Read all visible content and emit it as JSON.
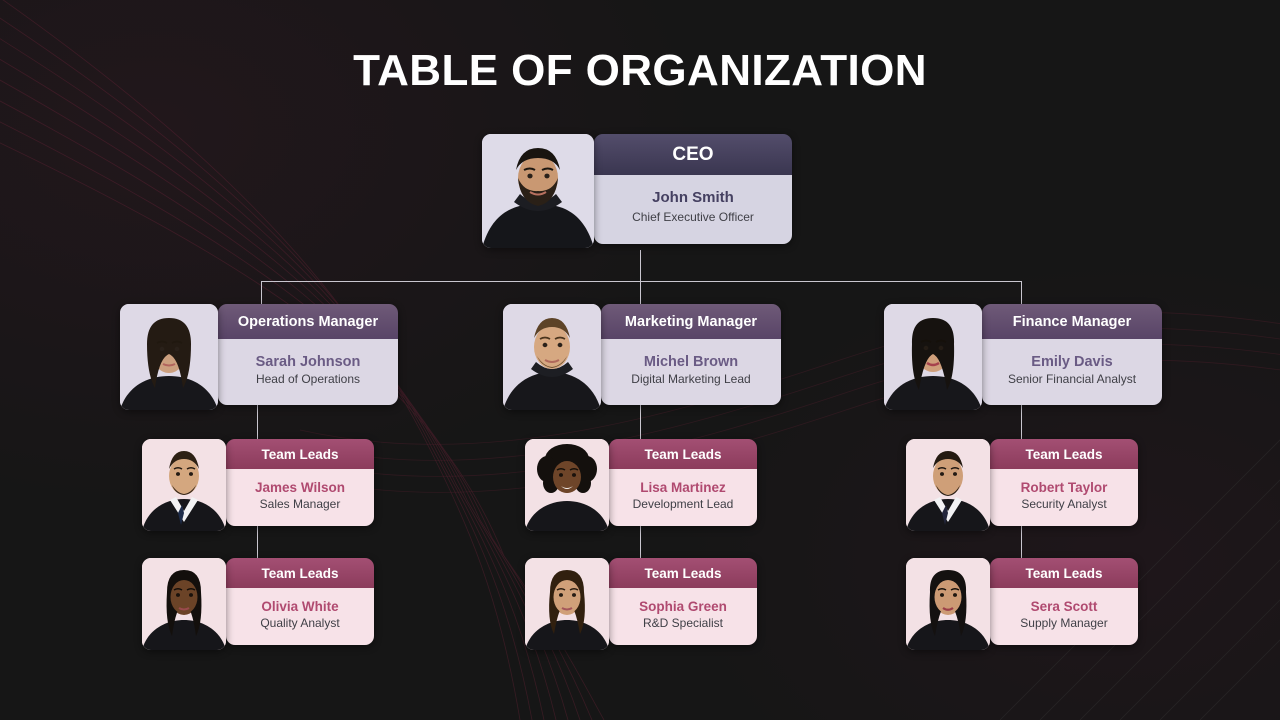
{
  "page": {
    "title": "TABLE OF ORGANIZATION",
    "background_color": "#161616",
    "connector_color": "#c9c6cf"
  },
  "palette": {
    "ceo_header_top": "#534d6b",
    "ceo_header_bottom": "#3a3650",
    "ceo_body": "#d6d4e2",
    "ceo_name": "#454061",
    "manager_header_top": "#6f5a78",
    "manager_header_bottom": "#584467",
    "manager_body": "#dcd7e4",
    "manager_name": "#6a5b84",
    "teamlead_header_top": "#a34f73",
    "teamlead_header_bottom": "#8c3c5c",
    "teamlead_body": "#f7e2e8",
    "teamlead_name": "#b04a70",
    "role_text": "#3f3f46"
  },
  "org": {
    "ceo": {
      "header": "CEO",
      "name": "John Smith",
      "role": "Chief Executive Officer",
      "photo_alt": "photo-john-smith"
    },
    "branches": [
      {
        "manager": {
          "header": "Operations Manager",
          "name": "Sarah Johnson",
          "role": "Head of Operations",
          "photo_alt": "photo-sarah-johnson"
        },
        "leads": [
          {
            "header": "Team Leads",
            "name": "James Wilson",
            "role": "Sales Manager",
            "photo_alt": "photo-james-wilson"
          },
          {
            "header": "Team Leads",
            "name": "Olivia White",
            "role": "Quality Analyst",
            "photo_alt": "photo-olivia-white"
          }
        ]
      },
      {
        "manager": {
          "header": "Marketing Manager",
          "name": "Michel Brown",
          "role": "Digital Marketing Lead",
          "photo_alt": "photo-michel-brown"
        },
        "leads": [
          {
            "header": "Team Leads",
            "name": "Lisa Martinez",
            "role": "Development Lead",
            "photo_alt": "photo-lisa-martinez"
          },
          {
            "header": "Team Leads",
            "name": "Sophia Green",
            "role": "R&D Specialist",
            "photo_alt": "photo-sophia-green"
          }
        ]
      },
      {
        "manager": {
          "header": "Finance Manager",
          "name": "Emily Davis",
          "role": "Senior Financial Analyst",
          "photo_alt": "photo-emily-davis"
        },
        "leads": [
          {
            "header": "Team Leads",
            "name": "Robert Taylor",
            "role": "Security Analyst",
            "photo_alt": "photo-robert-taylor"
          },
          {
            "header": "Team Leads",
            "name": "Sera Scott",
            "role": "Supply Manager",
            "photo_alt": "photo-sera-scott"
          }
        ]
      }
    ]
  }
}
